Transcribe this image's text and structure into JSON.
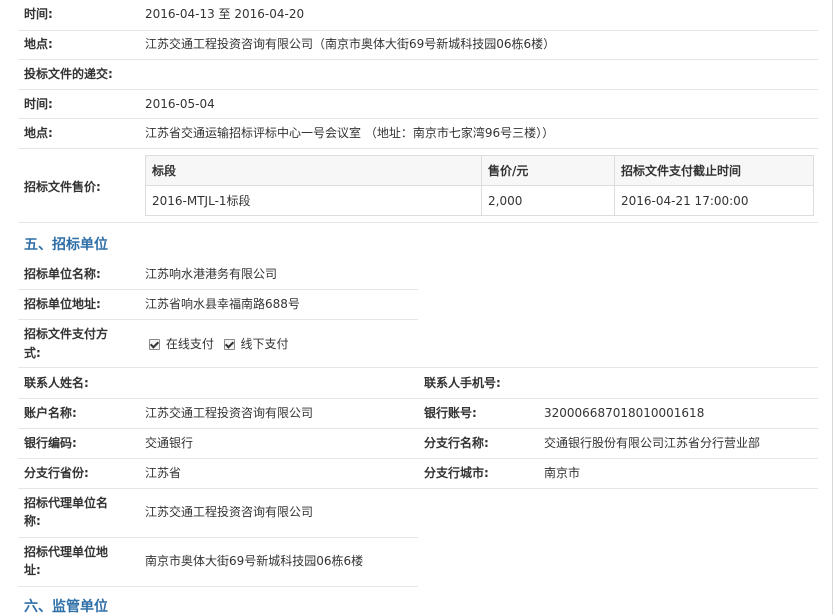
{
  "sale": {
    "time_label": "时间:",
    "time_value": "2016-04-13 至 2016-04-20",
    "place_label": "地点:",
    "place_value": "江苏交通工程投资咨询有限公司（南京市奥体大街69号新城科技园06栋6楼）"
  },
  "submission": {
    "heading": "投标文件的递交:",
    "time_label": "时间:",
    "time_value": "2016-05-04",
    "place_label": "地点:",
    "place_value": "江苏省交通运输招标评标中心一号会议室 （地址：南京市七家湾96号三楼））"
  },
  "price": {
    "label": "招标文件售价:",
    "headers": [
      "标段",
      "售价/元",
      "招标文件支付截止时间"
    ],
    "rows": [
      [
        "2016-MTJL-1标段",
        "2,000",
        "2016-04-21 17:00:00"
      ]
    ]
  },
  "section5": {
    "title": "五、招标单位",
    "name_label": "招标单位名称:",
    "name_value": "江苏响水港港务有限公司",
    "addr_label": "招标单位地址:",
    "addr_value": "江苏省响水县幸福南路688号",
    "pay_label_1": "招标文件支付方",
    "pay_label_2": "式:",
    "pay_online": "在线支付",
    "pay_offline": "线下支付",
    "contact_label": "联系人姓名:",
    "phone_label": "联系人手机号:",
    "account_name_label": "账户名称:",
    "account_name_value": "江苏交通工程投资咨询有限公司",
    "bank_account_label": "银行账号:",
    "bank_account_value": "32000668701801000161​8",
    "bank_code_label": "银行编码:",
    "bank_code_value": "交通银行",
    "branch_name_label": "分支行名称:",
    "branch_name_value": "交通银行股份有限公司江苏省分行营业部",
    "branch_prov_label": "分支行省份:",
    "branch_prov_value": "江苏省",
    "branch_city_label": "分支行城市:",
    "branch_city_value": "南京市",
    "agent_name_label_1": "招标代理单位名",
    "agent_name_label_2": "称:",
    "agent_name_value": "江苏交通工程投资咨询有限公司",
    "agent_addr_label_1": "招标代理单位地",
    "agent_addr_label_2": "址:",
    "agent_addr_value": "南京市奥体大街69号新城科技园06栋6楼"
  },
  "section6": {
    "title": "六、监管单位"
  }
}
